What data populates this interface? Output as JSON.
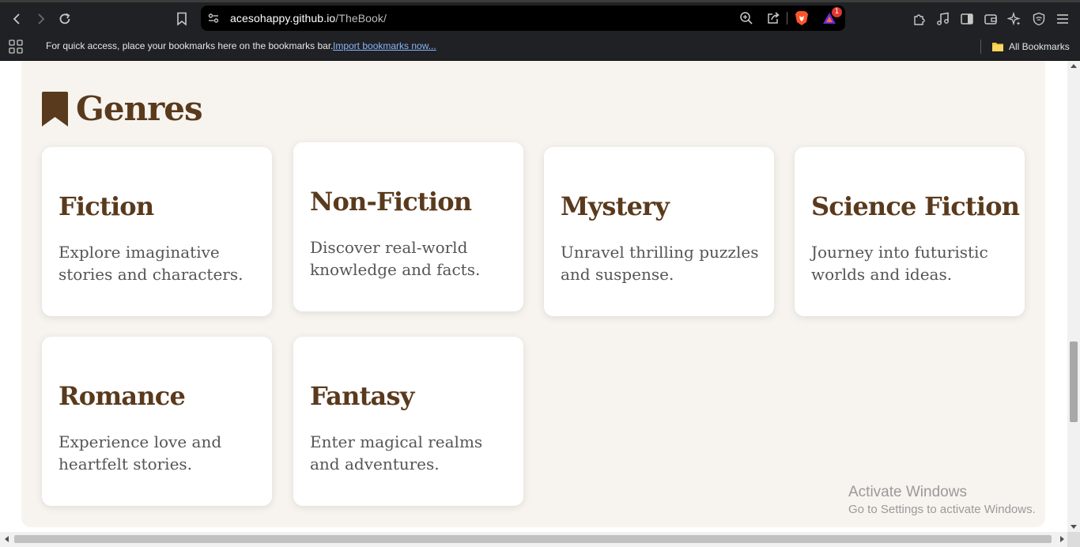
{
  "browser": {
    "url_host": "acesohappy.github.io",
    "url_path": "/TheBook/",
    "rewards_count": "1",
    "bookmarks_message": "For quick access, place your bookmarks here on the bookmarks bar.",
    "import_link": "Import bookmarks now...",
    "all_bookmarks": "All Bookmarks"
  },
  "section": {
    "heading": "Genres",
    "icon": "bookmark-icon",
    "accent_color": "#5a3a1c",
    "background_color": "#f7f4ef"
  },
  "genres": [
    {
      "title": "Fiction",
      "description": "Explore imaginative stories and characters."
    },
    {
      "title": "Non-Fiction",
      "description": "Discover real-world knowledge and facts."
    },
    {
      "title": "Mystery",
      "description": "Unravel thrilling puzzles and suspense."
    },
    {
      "title": "Science Fiction",
      "description": "Journey into futuristic worlds and ideas."
    },
    {
      "title": "Romance",
      "description": "Experience love and heartfelt stories."
    },
    {
      "title": "Fantasy",
      "description": "Enter magical realms and adventures."
    }
  ],
  "watermark": {
    "line1": "Activate Windows",
    "line2": "Go to Settings to activate Windows."
  }
}
